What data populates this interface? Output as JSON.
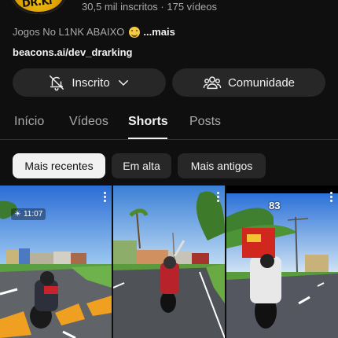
{
  "channel": {
    "stats": "30,5 mil inscritos · 175 vídeos",
    "description_text": "Jogos No L1NK ABAIXO",
    "description_more": "...mais",
    "link": "beacons.ai/dev_drarking",
    "avatar_text": "DR.Ki"
  },
  "buttons": {
    "subscribed_label": "Inscrito",
    "community_label": "Comunidade"
  },
  "tabs": [
    {
      "label": "Início",
      "active": false
    },
    {
      "label": "Vídeos",
      "active": false
    },
    {
      "label": "Shorts",
      "active": true
    },
    {
      "label": "Posts",
      "active": false
    }
  ],
  "chips": [
    {
      "label": "Mais recentes",
      "selected": true
    },
    {
      "label": "Em alta",
      "selected": false
    },
    {
      "label": "Mais antigos",
      "selected": false
    }
  ],
  "shorts": [
    {
      "overlay_time": "11:07",
      "icon": "sun-icon"
    },
    {},
    {
      "overlay_speed": "83"
    }
  ],
  "colors": {
    "background": "#0f0f0f",
    "pill": "#272727",
    "chip_selected": "#f1f1f1",
    "text_secondary": "#aaaaaa"
  }
}
